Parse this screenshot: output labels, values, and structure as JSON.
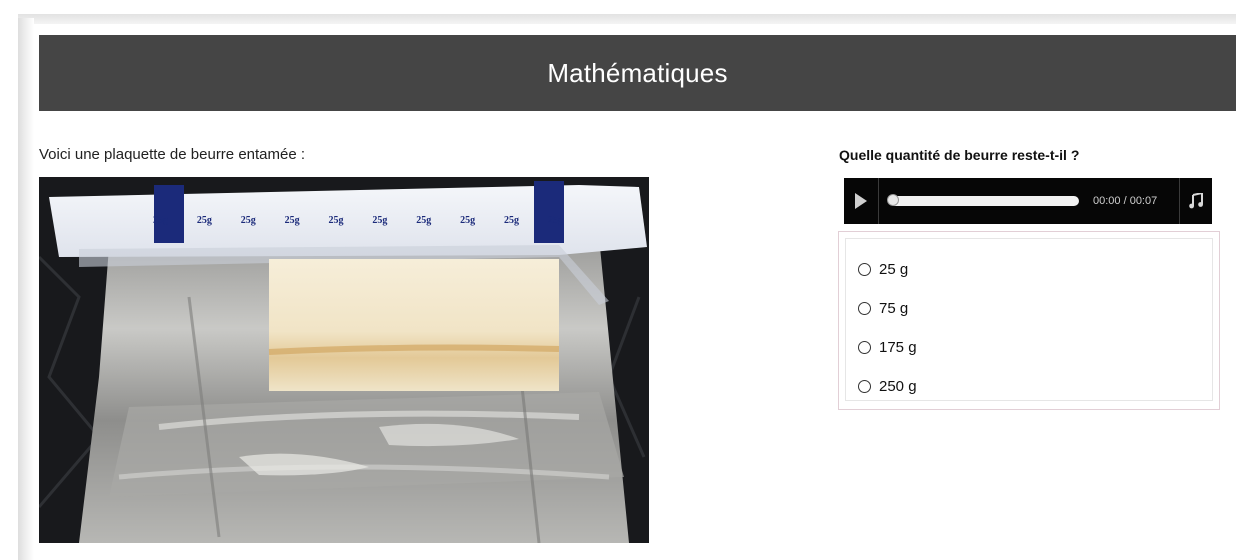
{
  "header": {
    "title": "Mathématiques"
  },
  "content": {
    "intro": "Voici une plaquette de beurre entamée :",
    "photo_labels": [
      "25g",
      "25g",
      "25g",
      "25g",
      "25g",
      "25g",
      "25g",
      "25g",
      "25g",
      "25g"
    ]
  },
  "question": {
    "text": "Quelle quantité de beurre reste-t-il ?",
    "audio": {
      "time": "00:00 / 00:07",
      "progress": 0
    },
    "options": [
      "25 g",
      "75 g",
      "175 g",
      "250 g"
    ]
  }
}
